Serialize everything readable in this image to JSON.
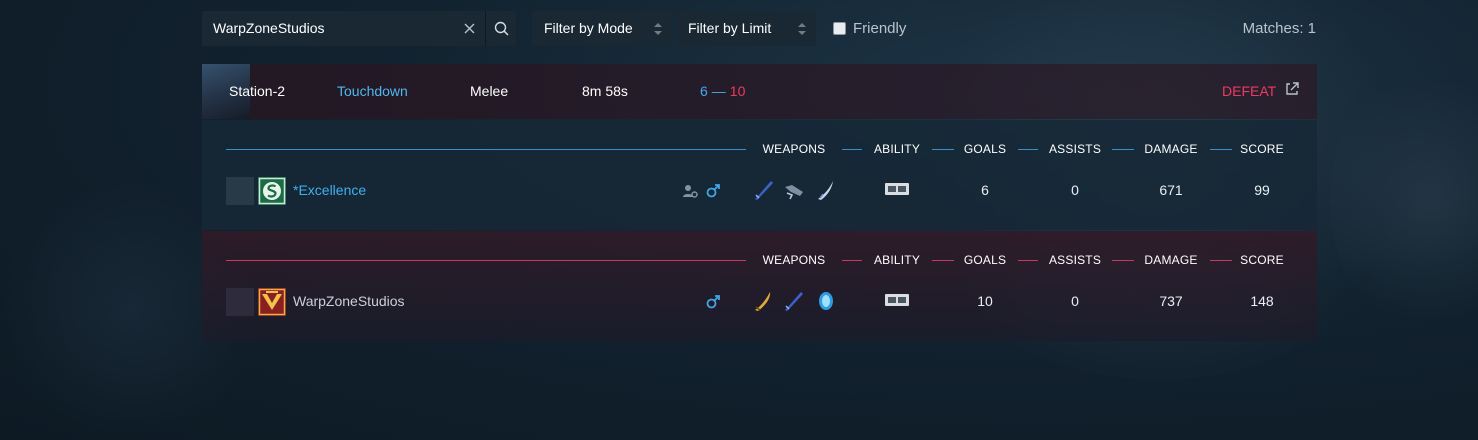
{
  "search": {
    "value": "WarpZoneStudios",
    "clear_icon": "close-icon",
    "search_icon": "search-icon"
  },
  "filters": {
    "mode": {
      "label": "Filter by Mode"
    },
    "limit": {
      "label": "Filter by Limit"
    },
    "friendly": {
      "label": "Friendly",
      "checked": false
    }
  },
  "matches_count": "Matches: 1",
  "match": {
    "map": "Station-2",
    "mode": "Touchdown",
    "type": "Melee",
    "duration": "8m 58s",
    "score_a": "6",
    "score_sep": "—",
    "score_b": "10",
    "result": "DEFEAT",
    "colors": {
      "blue": "#3fb0ef",
      "red": "#ee3a5e"
    }
  },
  "columns": {
    "weapons": "WEAPONS",
    "ability": "ABILITY",
    "goals": "GOALS",
    "assists": "ASSISTS",
    "damage": "DAMAGE",
    "score": "SCORE"
  },
  "teams": [
    {
      "player": {
        "name": "*Excellence",
        "goals": "6",
        "assists": "0",
        "damage": "671",
        "score": "99"
      },
      "icons": [
        "group-settings-icon",
        "male-icon"
      ],
      "weapons": [
        "blade-weapon-icon",
        "drone-weapon-icon",
        "claw-weapon-icon"
      ],
      "ability": "ability-chip-icon"
    },
    {
      "player": {
        "name": "WarpZoneStudios",
        "goals": "10",
        "assists": "0",
        "damage": "737",
        "score": "148"
      },
      "icons": [
        "male-icon"
      ],
      "weapons": [
        "golden-blade-weapon-icon",
        "blade-weapon-icon",
        "orb-weapon-icon"
      ],
      "ability": "ability-chip-icon"
    }
  ]
}
